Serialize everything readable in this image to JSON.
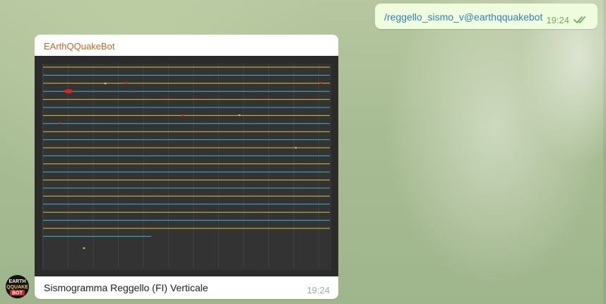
{
  "outgoing": {
    "text": "/reggello_sismo_v@earthqquakebot",
    "time": "19:24"
  },
  "incoming": {
    "sender": "EArthQQuakeBot",
    "caption": "Sismogramma Reggello (FI) Verticale",
    "time": "19:24"
  },
  "avatar": {
    "logo_text": "EARTH QQUAKE BOT"
  },
  "colors": {
    "outgoing_bubble": "#effdde",
    "link": "#2f7fb8",
    "sender_name": "#c8651d",
    "read_check": "#6cae5c",
    "trace_yellow": "#d8c43a",
    "trace_cyan": "#3fb6c8"
  },
  "icons": {
    "read_status": "double-check-icon"
  }
}
